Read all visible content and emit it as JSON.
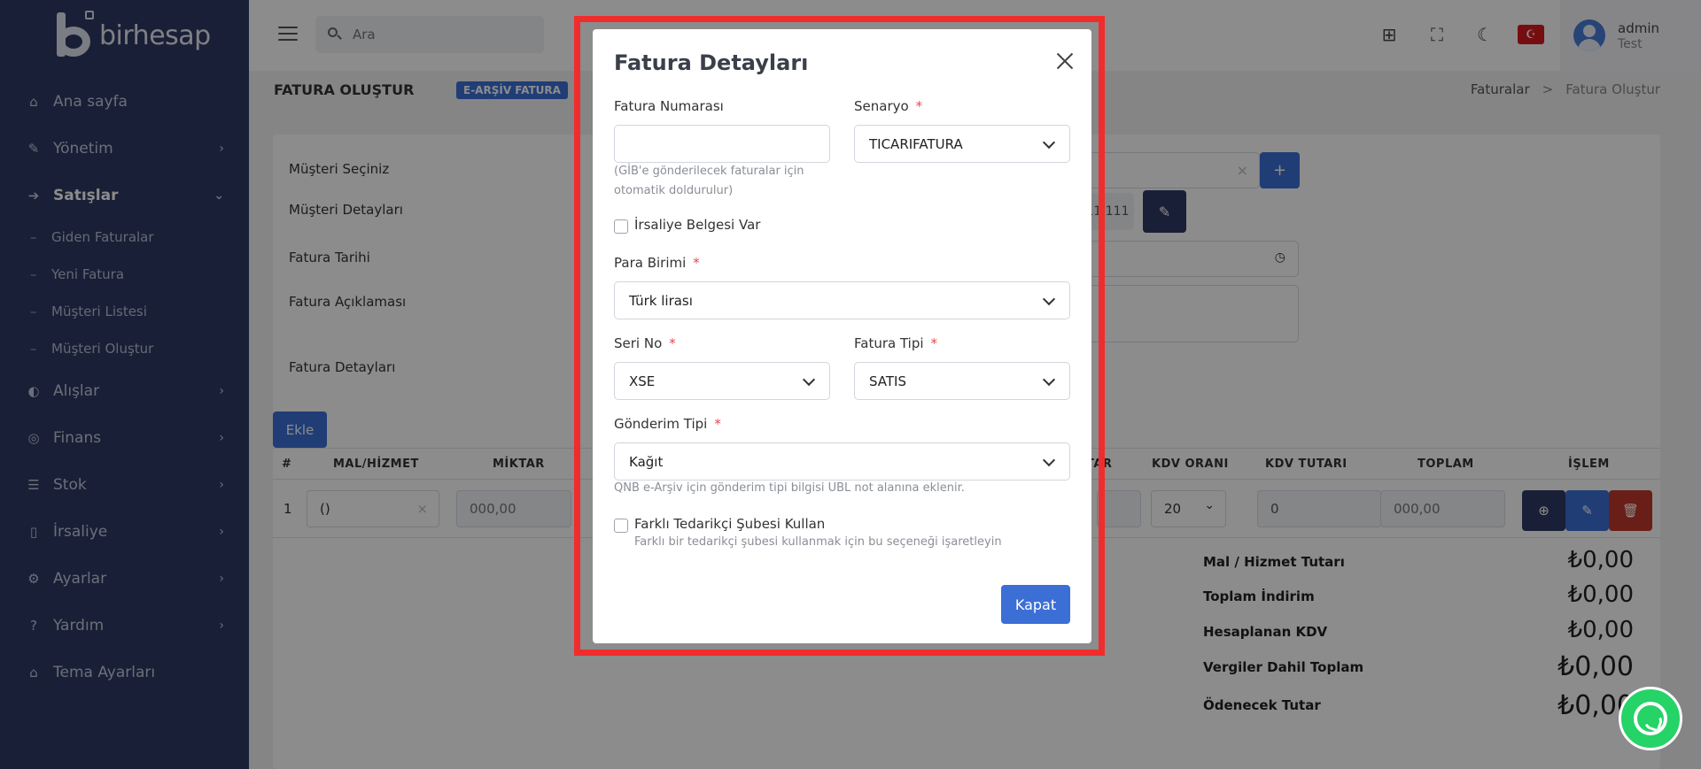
{
  "sidebar": {
    "logo_text": "birhesap",
    "items": [
      {
        "label": "Ana sayfa",
        "icon": "home-icon"
      },
      {
        "label": "Yönetim",
        "icon": "wrench-icon"
      },
      {
        "label": "Satışlar",
        "icon": "sales-icon"
      },
      {
        "label": "Alışlar",
        "icon": "purchases-icon"
      },
      {
        "label": "Finans",
        "icon": "finance-icon"
      },
      {
        "label": "Stok",
        "icon": "stock-icon"
      },
      {
        "label": "İrsaliye",
        "icon": "waybill-icon"
      },
      {
        "label": "Ayarlar",
        "icon": "settings-icon"
      },
      {
        "label": "Yardım",
        "icon": "help-icon"
      },
      {
        "label": "Tema Ayarları",
        "icon": "theme-icon"
      }
    ],
    "sub_items": [
      "Giden Faturalar",
      "Yeni Fatura",
      "Müşteri Listesi",
      "Müşteri Oluştur"
    ]
  },
  "topbar": {
    "search_placeholder": "Ara",
    "user_name": "admin",
    "user_role": "Test"
  },
  "page": {
    "title": "FATURA OLUŞTUR",
    "badge": "E-ARŞİV FATURA",
    "breadcrumb": [
      "Faturalar",
      "Fatura Oluştur"
    ]
  },
  "form": {
    "musteri_seciniz": "Müşteri Seçiniz",
    "musteri_detaylari": "Müşteri Detayları",
    "fatura_tarihi": "Fatura Tarihi",
    "fatura_aciklamasi": "Fatura Açıklaması",
    "fatura_detaylari": "Fatura Detayları",
    "musteri_detay_partial": "11 111",
    "add_label": "+",
    "ekle": "Ekle"
  },
  "table": {
    "headers": {
      "num": "#",
      "mal": "MAL/HİZMET",
      "miktar": "MİKTAR",
      "tar_partial": "TAR",
      "kdv_orani": "KDV ORANI",
      "kdv_tutari": "KDV TUTARI",
      "toplam": "TOPLAM",
      "islem": "İŞLEM"
    },
    "row": {
      "index": "1",
      "mal_value": "()",
      "miktar_placeholder": "000,00",
      "kdv_orani": "20",
      "kdv_tutari": "0",
      "toplam_placeholder": "000,00"
    }
  },
  "totals": [
    {
      "label": "Mal / Hizmet Tutarı",
      "value": "₺0,00"
    },
    {
      "label": "Toplam İndirim",
      "value": "₺0,00"
    },
    {
      "label": "Hesaplanan KDV",
      "value": "₺0,00"
    },
    {
      "label": "Vergiler Dahil Toplam",
      "value": "₺0,00"
    },
    {
      "label": "Ödenecek Tutar",
      "value": "₺0,00"
    }
  ],
  "modal": {
    "title": "Fatura Detayları",
    "fatura_numarasi_label": "Fatura Numarası",
    "fatura_numarasi_value": "",
    "fatura_numarasi_help": "(GİB'e gönderilecek faturalar için otomatik doldurulur)",
    "senaryo_label": "Senaryo",
    "senaryo_value": "TICARIFATURA",
    "irsaliye_label": "İrsaliye Belgesi Var",
    "para_birimi_label": "Para Birimi",
    "para_birimi_value": "Türk lirası",
    "seri_no_label": "Seri No",
    "seri_no_value": "XSE",
    "fatura_tipi_label": "Fatura Tipi",
    "fatura_tipi_value": "SATIS",
    "gonderim_tipi_label": "Gönderim Tipi",
    "gonderim_tipi_value": "Kağıt",
    "gonderim_help": "QNB e-Arşiv için gönderim tipi bilgisi UBL not alanına eklenir.",
    "farkli_label": "Farklı Tedarikçi Şubesi Kullan",
    "farkli_help": "Farklı bir tedarikçi şubesi kullanmak için bu seçeneği işaretleyin",
    "required_mark": "*",
    "close_label": "Kapat"
  },
  "colors": {
    "sidebar_bg": "#2f3a63",
    "accent": "#3b6fd6",
    "danger": "#c0392b",
    "highlight_frame": "#f02d2d",
    "whatsapp": "#25d366"
  }
}
